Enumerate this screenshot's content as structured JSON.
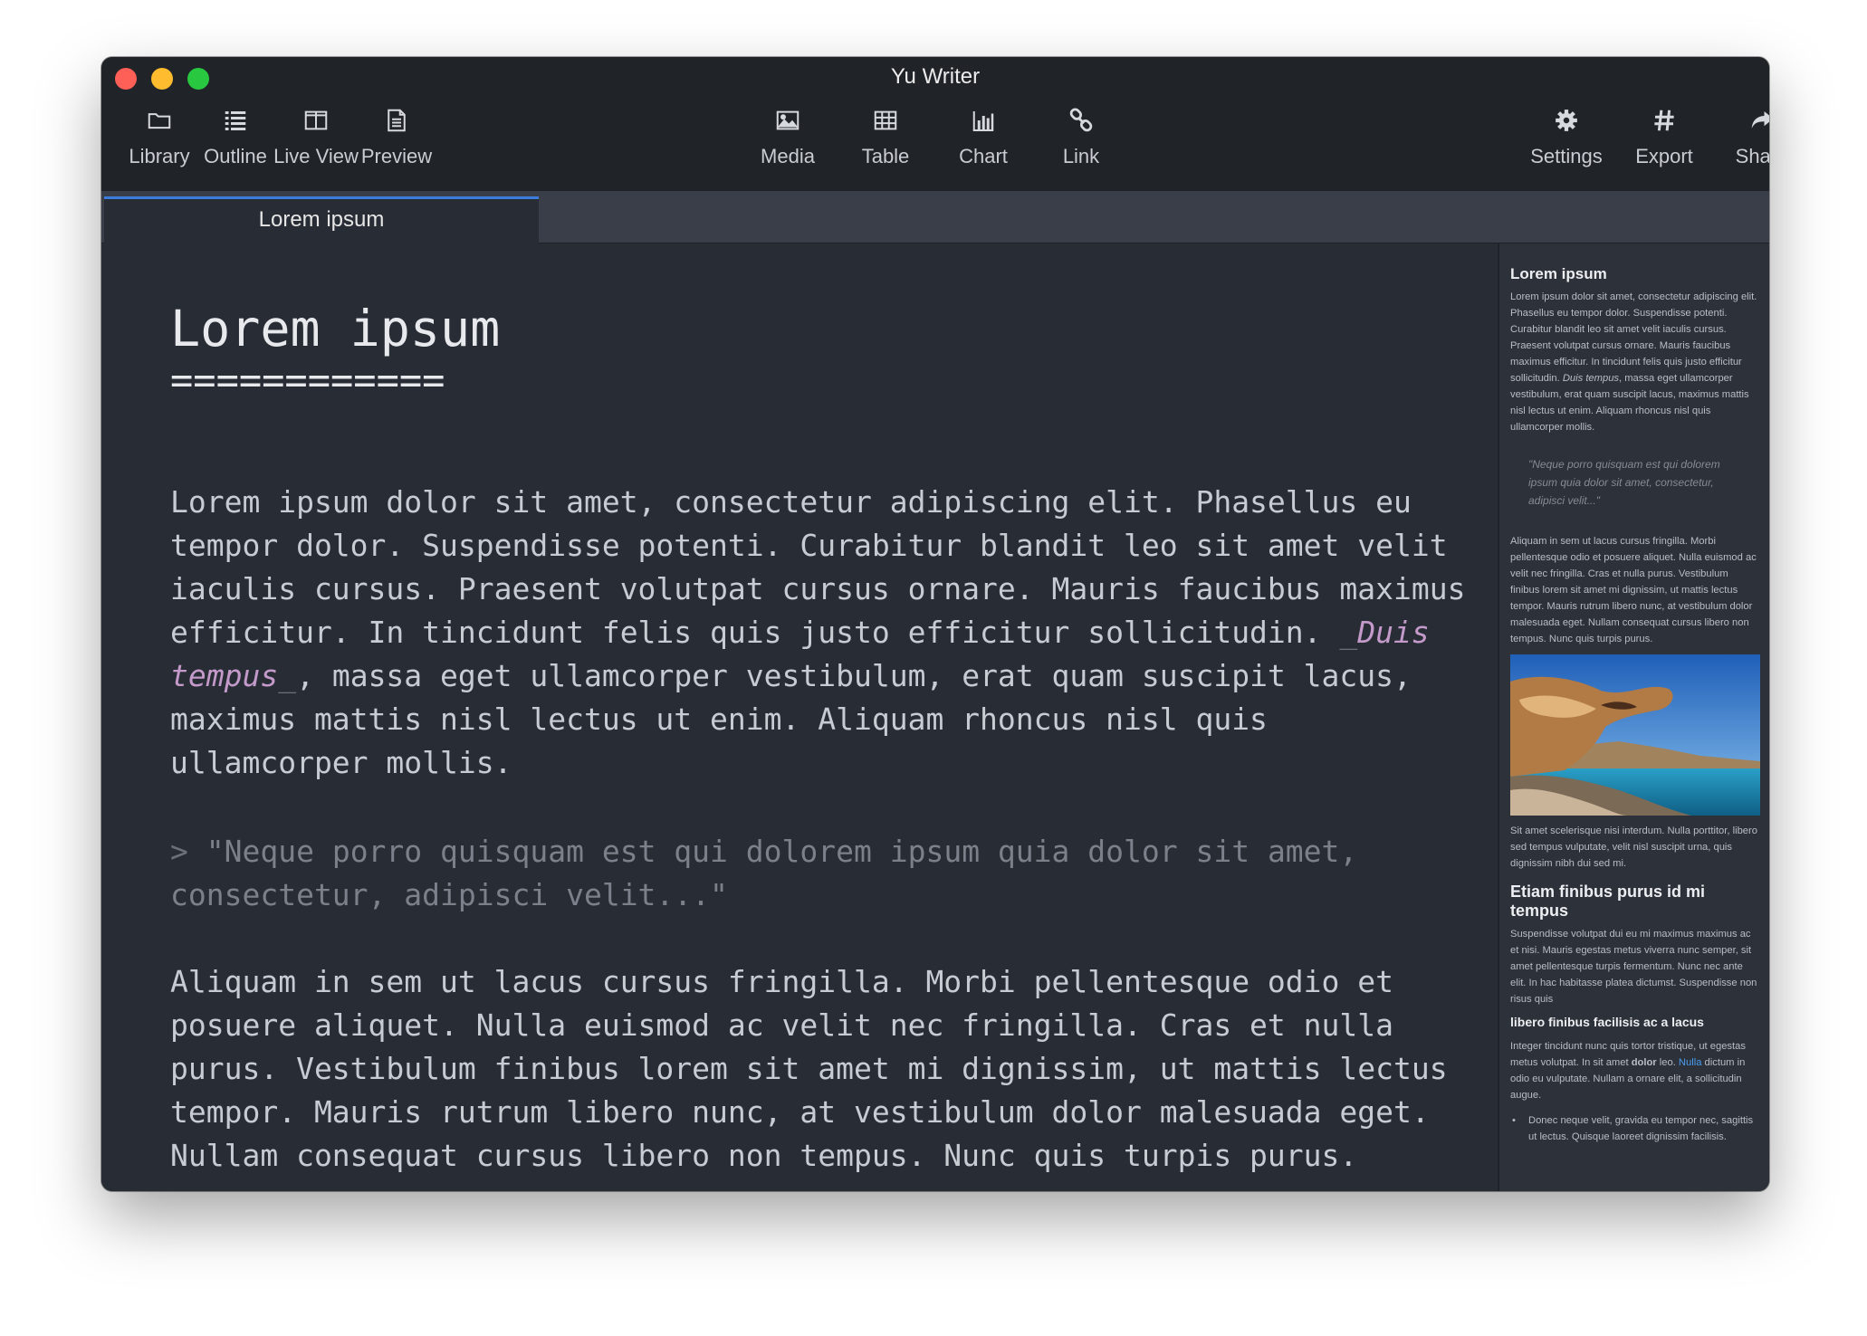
{
  "window": {
    "title": "Yu Writer"
  },
  "toolbar": {
    "left": [
      {
        "label": "Library",
        "icon": "folder-icon"
      },
      {
        "label": "Outline",
        "icon": "list-icon"
      },
      {
        "label": "Live View",
        "icon": "split-view-icon"
      },
      {
        "label": "Preview",
        "icon": "document-icon"
      }
    ],
    "center": [
      {
        "label": "Media",
        "icon": "image-icon"
      },
      {
        "label": "Table",
        "icon": "table-icon"
      },
      {
        "label": "Chart",
        "icon": "bar-chart-icon"
      },
      {
        "label": "Link",
        "icon": "link-icon"
      }
    ],
    "right": [
      {
        "label": "Settings",
        "icon": "gear-icon"
      },
      {
        "label": "Export",
        "icon": "hash-icon"
      },
      {
        "label": "Share",
        "icon": "share-icon"
      }
    ]
  },
  "tabs": [
    {
      "label": "Lorem ipsum",
      "active": true
    }
  ],
  "editor": {
    "heading": "Lorem ipsum",
    "heading_rule": "============",
    "para1_before": "Lorem ipsum dolor sit amet, consectetur adipiscing elit. Phasellus eu tempor dolor. Suspendisse potenti. Curabitur blandit leo sit amet velit iaculis cursus. Praesent volutpat cursus ornare. Mauris faucibus maximus efficitur. In tincidunt felis quis justo efficitur sollicitudin. ",
    "para1_em_open": "_",
    "para1_em": "Duis tempus",
    "para1_em_close": "_",
    "para1_after": ", massa eget ullamcorper vestibulum, erat quam suscipit lacus, maximus mattis nisl lectus ut enim. Aliquam rhoncus nisl quis ullamcorper mollis.",
    "quote_marker": "> ",
    "quote": "\"Neque porro quisquam est qui dolorem ipsum quia dolor sit amet, consectetur, adipisci velit...\"",
    "para2": "Aliquam in sem ut lacus cursus fringilla. Morbi pellentesque odio et posuere aliquet. Nulla euismod ac velit nec fringilla. Cras et nulla purus. Vestibulum finibus lorem sit amet mi dignissim, ut mattis lectus tempor. Mauris rutrum libero nunc, at vestibulum dolor malesuada eget. Nullam consequat cursus libero non tempus. Nunc quis turpis purus."
  },
  "preview": {
    "h1": "Lorem ipsum",
    "p1_before": "Lorem ipsum dolor sit amet, consectetur adipiscing elit. Phasellus eu tempor dolor. Suspendisse potenti. Curabitur blandit leo sit amet velit iaculis cursus. Praesent volutpat cursus ornare. Mauris faucibus maximus efficitur. In tincidunt felis quis justo efficitur sollicitudin. ",
    "p1_em": "Duis tempus",
    "p1_after": ", massa eget ullamcorper vestibulum, erat quam suscipit lacus, maximus mattis nisl lectus ut enim. Aliquam rhoncus nisl quis ullamcorper mollis.",
    "quote": "\"Neque porro quisquam est qui dolorem ipsum quia dolor sit amet, consectetur, adipisci velit...\"",
    "p2": "Aliquam in sem ut lacus cursus fringilla. Morbi pellentesque odio et posuere aliquet. Nulla euismod ac velit nec fringilla. Cras et nulla purus. Vestibulum finibus lorem sit amet mi dignissim, ut mattis lectus tempor. Mauris rutrum libero nunc, at vestibulum dolor malesuada eget. Nullam consequat cursus libero non tempus. Nunc quis turpis purus.",
    "p3": "Sit amet scelerisque nisi interdum. Nulla porttitor, libero sed tempus vulputate, velit nisl suscipit urna, quis dignissim nibh dui sed mi.",
    "h2": "Etiam finibus purus id mi tempus",
    "p4": "Suspendisse volutpat dui eu mi maximus maximus ac et nisi. Mauris egestas metus viverra nunc semper, sit amet pellentesque turpis fermentum. Nunc nec ante elit. In hac habitasse platea dictumst. Suspendisse non risus quis",
    "h3": "libero finibus facilisis ac a lacus",
    "p5_before": "Integer tincidunt nunc quis tortor tristique, ut egestas metus volutpat. In sit amet ",
    "p5_bold": "dolor",
    "p5_mid": " leo. ",
    "p5_link": "Nulla",
    "p5_after": " dictum in odio eu vulputate. Nullam a ornare elit, a sollicitudin augue.",
    "li1": "Donec neque velit, gravida eu tempor nec, sagittis ut lectus. Quisque laoreet dignissim facilisis."
  },
  "colors": {
    "window_bg": "#282c35",
    "toolbar_bg": "#202328",
    "tab_accent": "#3b7ddd",
    "emphasis": "#c39ac9",
    "link": "#4a9df0"
  }
}
